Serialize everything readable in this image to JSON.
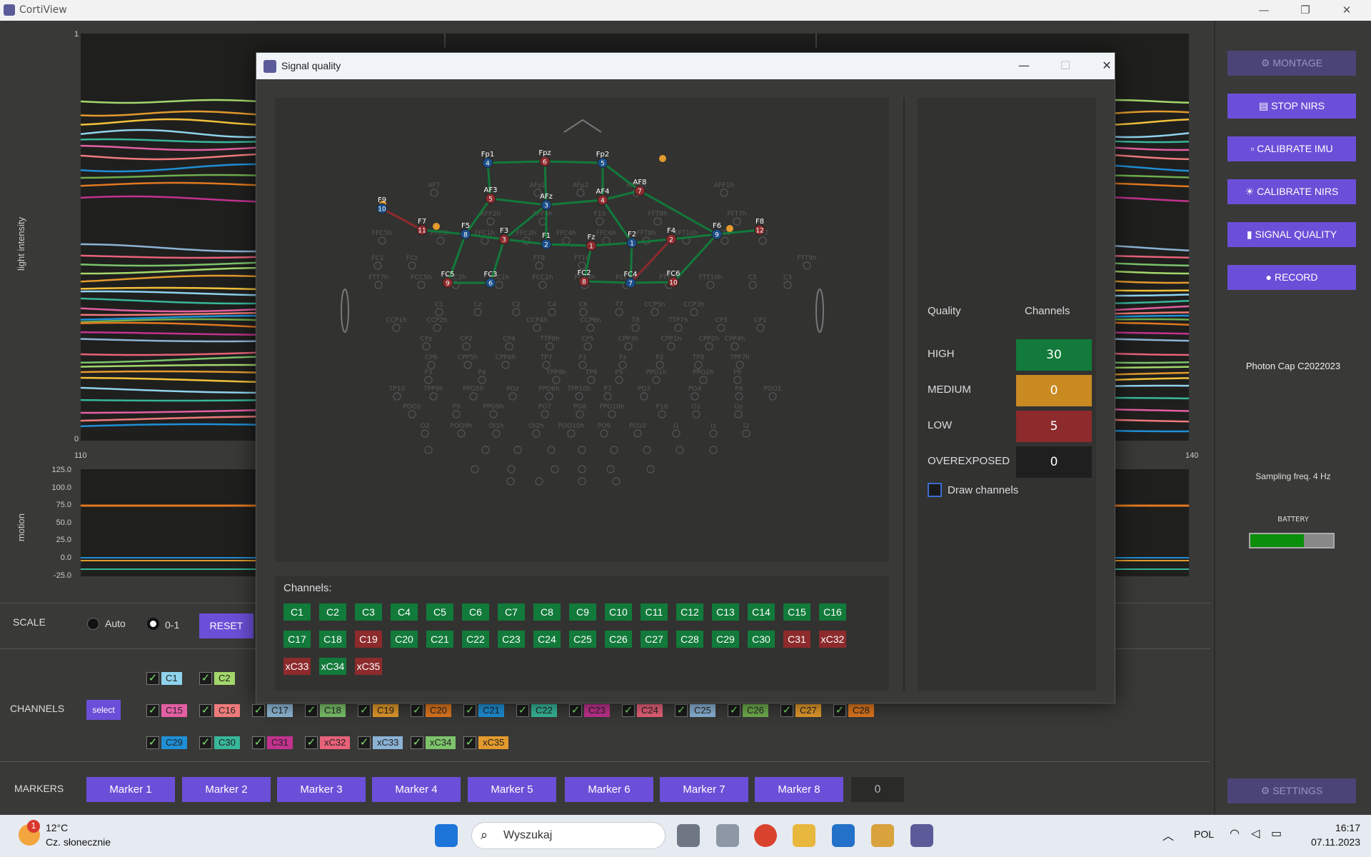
{
  "app": {
    "title": "CortiView",
    "win_min": "—",
    "win_max": "❐",
    "win_close": "✕"
  },
  "plot": {
    "y_label": "light intensity",
    "y_top": "1",
    "y_bottom": "0",
    "x_left": "110",
    "x_right": "140"
  },
  "motion": {
    "y_label": "motion",
    "ticks": [
      "125.0",
      "100.0",
      "75.0",
      "50.0",
      "25.0",
      "0.0",
      "-25.0"
    ]
  },
  "scale": {
    "label": "SCALE",
    "auto": "Auto",
    "range": "0-1",
    "reset": "RESET"
  },
  "channels_section": {
    "label": "CHANNELS",
    "select": "select",
    "rows": [
      [
        {
          "n": "C1",
          "c": "#8fd3ee",
          "on": true
        },
        {
          "n": "C2",
          "c": "#a4d76b",
          "on": true
        }
      ],
      [
        {
          "n": "C15",
          "c": "#e35fa3",
          "on": true
        },
        {
          "n": "C16",
          "c": "#ef7b7b",
          "on": true
        },
        {
          "n": "C17",
          "c": "#8fb9d8",
          "on": true
        },
        {
          "n": "C18",
          "c": "#7cc36b",
          "on": true
        },
        {
          "n": "C19",
          "c": "#e39a2c",
          "on": true
        },
        {
          "n": "C20",
          "c": "#e0781f",
          "on": true
        },
        {
          "n": "C21",
          "c": "#1f8fd6",
          "on": true
        },
        {
          "n": "C22",
          "c": "#38b79a",
          "on": true
        },
        {
          "n": "C23",
          "c": "#c2328f",
          "on": true
        },
        {
          "n": "C24",
          "c": "#e8627a",
          "on": true
        },
        {
          "n": "C25",
          "c": "#8bb3d6",
          "on": true
        },
        {
          "n": "C26",
          "c": "#6fae4e",
          "on": true
        },
        {
          "n": "C27",
          "c": "#e39a2c",
          "on": true
        },
        {
          "n": "C28",
          "c": "#e0781f",
          "on": true
        }
      ],
      [
        {
          "n": "C29",
          "c": "#1f8fd6",
          "on": true
        },
        {
          "n": "C30",
          "c": "#38b79a",
          "on": true
        },
        {
          "n": "C31",
          "c": "#c2328f",
          "on": true
        },
        {
          "n": "xC32",
          "c": "#e8627a",
          "on": true
        },
        {
          "n": "xC33",
          "c": "#8bb3d6",
          "on": true
        },
        {
          "n": "xC34",
          "c": "#7cc36b",
          "on": true
        },
        {
          "n": "xC35",
          "c": "#e39a2c",
          "on": true
        }
      ]
    ]
  },
  "markers": {
    "label": "MARKERS",
    "items": [
      "Marker 1",
      "Marker 2",
      "Marker 3",
      "Marker 4",
      "Marker 5",
      "Marker 6",
      "Marker 7",
      "Marker 8"
    ],
    "count": "0"
  },
  "right": {
    "montage": "MONTAGE",
    "stop_nirs": "STOP NIRS",
    "cal_imu": "CALIBRATE IMU",
    "cal_nirs": "CALIBRATE NIRS",
    "sig_quality": "SIGNAL QUALITY",
    "record": "RECORD",
    "device": "Photon Cap C2022023",
    "sampling": "Sampling freq. 4 Hz",
    "battery_label": "BATTERY",
    "battery_level": 0.65,
    "settings": "SETTINGS"
  },
  "dialog": {
    "title": "Signal quality",
    "quality": {
      "header_q": "Quality",
      "header_c": "Channels",
      "rows": [
        {
          "label": "HIGH",
          "value": "30",
          "color": "#127a3a"
        },
        {
          "label": "MEDIUM",
          "value": "0",
          "color": "#c98a22"
        },
        {
          "label": "LOW",
          "value": "5",
          "color": "#8c2a2c"
        },
        {
          "label": "OVEREXPOSED",
          "value": "0",
          "color": "#1f1f1f"
        }
      ]
    },
    "draw_channels": "Draw channels",
    "channels_label": "Channels:",
    "channels": [
      [
        "C1",
        "g"
      ],
      [
        "C2",
        "g"
      ],
      [
        "C3",
        "g"
      ],
      [
        "C4",
        "g"
      ],
      [
        "C5",
        "g"
      ],
      [
        "C6",
        "g"
      ],
      [
        "C7",
        "g"
      ],
      [
        "C8",
        "g"
      ],
      [
        "C9",
        "g"
      ],
      [
        "C10",
        "g"
      ],
      [
        "C11",
        "g"
      ],
      [
        "C12",
        "g"
      ],
      [
        "C13",
        "g"
      ],
      [
        "C14",
        "g"
      ],
      [
        "C15",
        "g"
      ],
      [
        "C16",
        "g"
      ],
      [
        "C17",
        "g"
      ],
      [
        "C18",
        "g"
      ],
      [
        "C19",
        "r"
      ],
      [
        "C20",
        "g"
      ],
      [
        "C21",
        "g"
      ],
      [
        "C22",
        "g"
      ],
      [
        "C23",
        "g"
      ],
      [
        "C24",
        "g"
      ],
      [
        "C25",
        "g"
      ],
      [
        "C26",
        "g"
      ],
      [
        "C27",
        "g"
      ],
      [
        "C28",
        "g"
      ],
      [
        "C29",
        "g"
      ],
      [
        "C30",
        "g"
      ],
      [
        "C31",
        "r"
      ],
      [
        "xC32",
        "r"
      ],
      [
        "xC33",
        "r"
      ],
      [
        "xC34",
        "g"
      ],
      [
        "xC35",
        "r"
      ]
    ],
    "sources": [
      {
        "name": "Fp1",
        "num": "4",
        "t": "b"
      },
      {
        "name": "Fpz",
        "num": "6",
        "t": "r"
      },
      {
        "name": "Fp2",
        "num": "5",
        "t": "b"
      },
      {
        "name": "AF3",
        "num": "5",
        "t": "r"
      },
      {
        "name": "AFz",
        "num": "3",
        "t": "b"
      },
      {
        "name": "AF4",
        "num": "4",
        "t": "r"
      },
      {
        "name": "AF8",
        "num": "7",
        "t": "r"
      },
      {
        "name": "F9",
        "num": "10",
        "t": "b"
      },
      {
        "name": "F7",
        "num": "11",
        "t": "r"
      },
      {
        "name": "F5",
        "num": "8",
        "t": "b"
      },
      {
        "name": "F3",
        "num": "3",
        "t": "r"
      },
      {
        "name": "F1",
        "num": "2",
        "t": "b"
      },
      {
        "name": "Fz",
        "num": "1",
        "t": "r"
      },
      {
        "name": "F2",
        "num": "1",
        "t": "b"
      },
      {
        "name": "F4",
        "num": "2",
        "t": "r"
      },
      {
        "name": "F6",
        "num": "9",
        "t": "b"
      },
      {
        "name": "F8",
        "num": "12",
        "t": "r"
      },
      {
        "name": "FC5",
        "num": "9",
        "t": "r"
      },
      {
        "name": "FC3",
        "num": "6",
        "t": "b"
      },
      {
        "name": "FC2",
        "num": "8",
        "t": "r"
      },
      {
        "name": "FC4",
        "num": "7",
        "t": "b"
      },
      {
        "name": "FC6",
        "num": "10",
        "t": "r"
      }
    ],
    "grey_labels": [
      "AF7",
      "AFp1",
      "AFp2",
      "AFF5h",
      "AFF1h",
      "AFF2h",
      "AFF6h",
      "F10",
      "FFT9h",
      "FFT7h",
      "FFC5h",
      "FFC3h",
      "FFC1h",
      "FFC2h",
      "FFC4h",
      "FFC6h",
      "FFT8h",
      "FFT10h",
      "FT9",
      "FT7",
      "FC1",
      "FCz",
      "FT8",
      "FT10",
      "FTT9h",
      "FTT7h",
      "FCC5h",
      "FCC3h",
      "FCC1h",
      "FCC2h",
      "FCC4h",
      "FCC6h",
      "FTT8h",
      "FTT10h",
      "C5",
      "C3",
      "C1",
      "Cz",
      "C2",
      "C4",
      "C6",
      "T7",
      "CCP5h",
      "CCP3h",
      "CCP1h",
      "CCP2h",
      "CCP4h",
      "CCP6h",
      "T8",
      "TTP7h",
      "CP3",
      "CP1",
      "CPz",
      "CP2",
      "CP4",
      "TTP8h",
      "CP5",
      "CPP3h",
      "CPP1h",
      "CPP2h",
      "CPP4h",
      "CP6",
      "CPP5h",
      "CPP6h",
      "TP7",
      "P1",
      "Pz",
      "P2",
      "TP8",
      "TPP7h",
      "P3",
      "P4",
      "TPP8h",
      "TP9",
      "P5",
      "PPO1h",
      "PPO2h",
      "P6",
      "TP10",
      "TPP9h",
      "PPO5h",
      "POz",
      "PPO6h",
      "TPP10h",
      "P7",
      "PO3",
      "PO4",
      "P8",
      "POO1",
      "POO2",
      "P9",
      "PPO9h",
      "PO7",
      "PO8",
      "PPO10h",
      "P10",
      "O1",
      "Oz",
      "O2",
      "POO9h",
      "OI1h",
      "OI2h",
      "POO10h",
      "PO9",
      "PO10",
      "I1",
      "Iz",
      "I2"
    ]
  },
  "taskbar": {
    "temp": "12°C",
    "weather": "Cz. słonecznie",
    "badge": "1",
    "search": "Wyszukaj",
    "lang": "POL",
    "time": "16:17",
    "date": "07.11.2023"
  }
}
